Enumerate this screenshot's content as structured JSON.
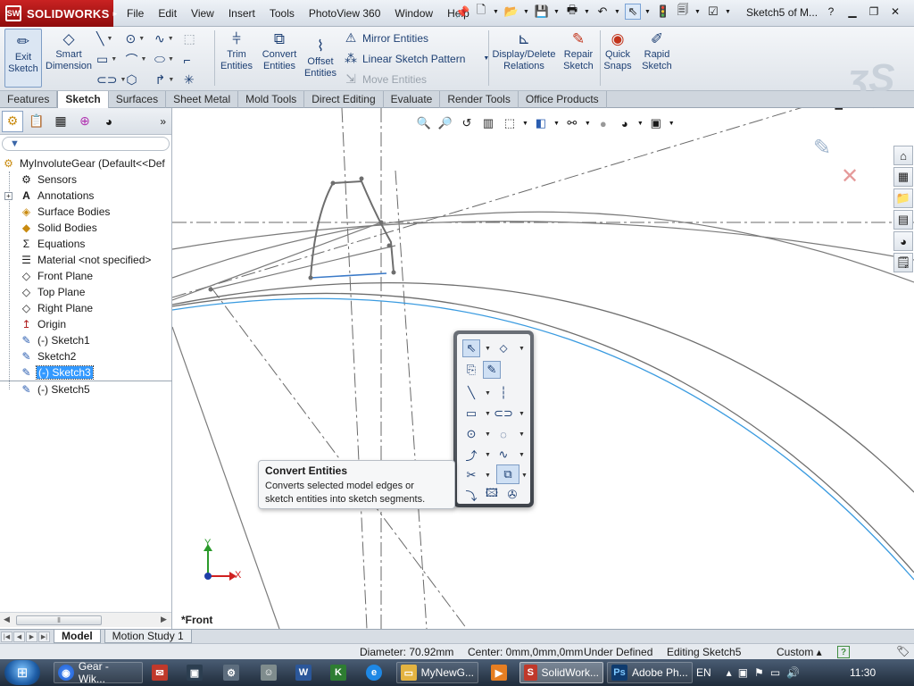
{
  "titlebar": {
    "brand": "SOLIDWORKS",
    "menu": [
      "File",
      "Edit",
      "View",
      "Insert",
      "Tools",
      "PhotoView 360",
      "Window",
      "Help"
    ],
    "document_title": "Sketch5 of M..."
  },
  "command_manager": {
    "exit_sketch": "Exit Sketch",
    "smart_dimension": "Smart Dimension",
    "trim_entities": "Trim Entities",
    "convert_entities": "Convert Entities",
    "offset_entities": "Offset Entities",
    "mirror_entities": "Mirror Entities",
    "linear_sketch_pattern": "Linear Sketch Pattern",
    "move_entities": "Move Entities",
    "display_delete_relations": "Display/Delete Relations",
    "repair_sketch": "Repair Sketch",
    "quick_snaps": "Quick Snaps",
    "rapid_sketch": "Rapid Sketch"
  },
  "tabs": [
    "Features",
    "Sketch",
    "Surfaces",
    "Sheet Metal",
    "Mold Tools",
    "Direct Editing",
    "Evaluate",
    "Render Tools",
    "Office Products"
  ],
  "active_tab": "Sketch",
  "feature_tree": {
    "root": "MyInvoluteGear  (Default<<Def",
    "items": [
      {
        "label": "Sensors",
        "icon": "sensor-icon"
      },
      {
        "label": "Annotations",
        "icon": "annotations-icon"
      },
      {
        "label": "Surface Bodies",
        "icon": "surface-bodies-icon"
      },
      {
        "label": "Solid Bodies",
        "icon": "solid-bodies-icon"
      },
      {
        "label": "Equations",
        "icon": "equations-icon"
      },
      {
        "label": "Material <not specified>",
        "icon": "material-icon"
      },
      {
        "label": "Front Plane",
        "icon": "plane-icon"
      },
      {
        "label": "Top Plane",
        "icon": "plane-icon"
      },
      {
        "label": "Right Plane",
        "icon": "plane-icon"
      },
      {
        "label": "Origin",
        "icon": "origin-icon"
      },
      {
        "label": "(-) Sketch1",
        "icon": "sketch-icon"
      },
      {
        "label": "Sketch2",
        "icon": "sketch-icon"
      },
      {
        "label": "(-) Sketch3",
        "icon": "sketch-icon",
        "selected": true
      },
      {
        "label": "(-) Sketch5",
        "icon": "sketch-icon"
      }
    ]
  },
  "graphics": {
    "view_name": "*Front",
    "axis_x": "X",
    "axis_y": "Y"
  },
  "tooltip": {
    "title": "Convert Entities",
    "description_line1": "Converts selected model edges or",
    "description_line2": "sketch entities into sketch segments."
  },
  "bottom_tabs": [
    "Model",
    "Motion Study 1"
  ],
  "statusbar": {
    "diameter": "Diameter: 70.92mm",
    "center": "Center: 0mm,0mm,0mm",
    "state": "Under Defined",
    "editing": "Editing Sketch5",
    "units": "Custom ▴"
  },
  "taskbar": {
    "items": [
      "Gear - Wik...",
      "MyNewG...",
      "SolidWork...",
      "Adobe Ph..."
    ],
    "language": "EN",
    "time": "11:30"
  },
  "colors": {
    "brand_red": "#b51818",
    "sketch_blue": "#3399ff",
    "selection": "#3399ff"
  }
}
